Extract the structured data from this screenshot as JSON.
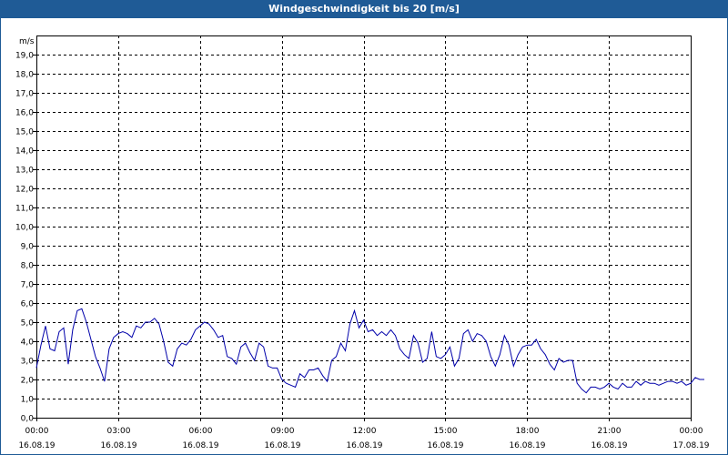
{
  "window": {
    "title": "Windgeschwindigkeit bis 20 [m/s]"
  },
  "chart_data": {
    "type": "line",
    "title": "Windgeschwindigkeit bis 20 [m/s]",
    "ylabel": "m/s",
    "ylim": [
      0,
      20
    ],
    "y_ticks": [
      "0,0",
      "1,0",
      "2,0",
      "3,0",
      "4,0",
      "5,0",
      "6,0",
      "7,0",
      "8,0",
      "9,0",
      "10,0",
      "11,0",
      "12,0",
      "13,0",
      "14,0",
      "15,0",
      "16,0",
      "17,0",
      "18,0",
      "19,0"
    ],
    "x_ticks": [
      {
        "time": "00:00",
        "date": "16.08.19"
      },
      {
        "time": "03:00",
        "date": "16.08.19"
      },
      {
        "time": "06:00",
        "date": "16.08.19"
      },
      {
        "time": "09:00",
        "date": "16.08.19"
      },
      {
        "time": "12:00",
        "date": "16.08.19"
      },
      {
        "time": "15:00",
        "date": "16.08.19"
      },
      {
        "time": "18:00",
        "date": "16.08.19"
      },
      {
        "time": "21:00",
        "date": "16.08.19"
      },
      {
        "time": "00:00",
        "date": "17.08.19"
      }
    ],
    "grid": true,
    "line_color": "#0000aa",
    "series": [
      {
        "x_start": "16.08.19 00:00",
        "x_step_minutes": 10,
        "values": [
          2.6,
          3.8,
          4.8,
          3.6,
          3.5,
          4.5,
          4.7,
          2.8,
          4.6,
          5.6,
          5.7,
          5.0,
          4.1,
          3.2,
          2.6,
          1.9,
          3.6,
          4.2,
          4.4,
          4.5,
          4.4,
          4.2,
          4.8,
          4.7,
          5.0,
          5.0,
          5.2,
          4.9,
          4.0,
          2.9,
          2.7,
          3.6,
          3.9,
          3.8,
          4.1,
          4.6,
          4.8,
          5.0,
          4.9,
          4.6,
          4.2,
          4.3,
          3.2,
          3.1,
          2.8,
          3.7,
          3.9,
          3.4,
          3.0,
          3.9,
          3.7,
          2.7,
          2.6,
          2.6,
          2.0,
          1.8,
          1.7,
          1.6,
          2.3,
          2.1,
          2.5,
          2.5,
          2.6,
          2.2,
          1.9,
          3.0,
          3.2,
          3.9,
          3.5,
          4.9,
          5.6,
          4.7,
          5.1,
          4.5,
          4.6,
          4.3,
          4.5,
          4.3,
          4.6,
          4.3,
          3.6,
          3.3,
          3.1,
          4.3,
          3.9,
          2.9,
          3.1,
          4.5,
          3.2,
          3.1,
          3.3,
          3.7,
          2.7,
          3.1,
          4.4,
          4.6,
          4.0,
          4.4,
          4.3,
          4.0,
          3.2,
          2.7,
          3.3,
          4.3,
          3.8,
          2.7,
          3.3,
          3.7,
          3.8,
          3.8,
          4.1,
          3.6,
          3.3,
          2.8,
          2.5,
          3.1,
          2.9,
          3.0,
          3.0,
          1.8,
          1.5,
          1.3,
          1.6,
          1.6,
          1.5,
          1.6,
          1.8,
          1.6,
          1.5,
          1.8,
          1.6,
          1.6,
          1.9,
          1.7,
          1.9,
          1.8,
          1.8,
          1.7,
          1.8,
          1.9,
          1.9,
          1.8,
          1.9,
          1.7,
          1.8,
          2.1,
          2.0,
          2.0
        ]
      }
    ]
  }
}
